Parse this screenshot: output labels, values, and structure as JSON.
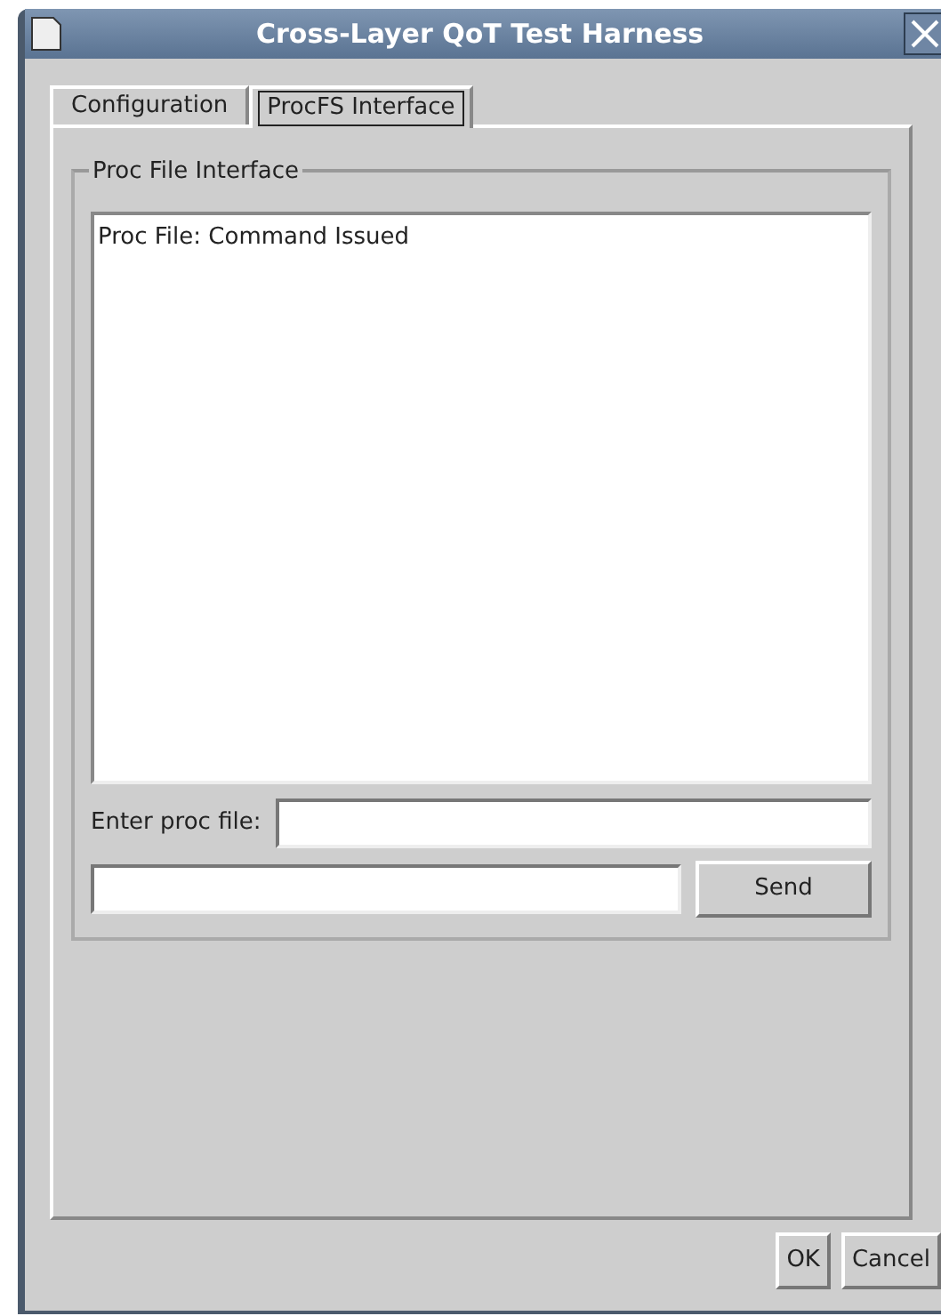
{
  "window": {
    "title": "Cross-Layer QoT Test Harness"
  },
  "tabs": [
    {
      "label": "Configuration",
      "selected": false
    },
    {
      "label": "ProcFS Interface",
      "selected": true
    }
  ],
  "group": {
    "title": "Proc File Interface",
    "log": "Proc File: Command Issued",
    "proc_file_label": "Enter proc file:",
    "send_button": "Send"
  },
  "buttons": [
    "OK",
    "Cancel"
  ]
}
